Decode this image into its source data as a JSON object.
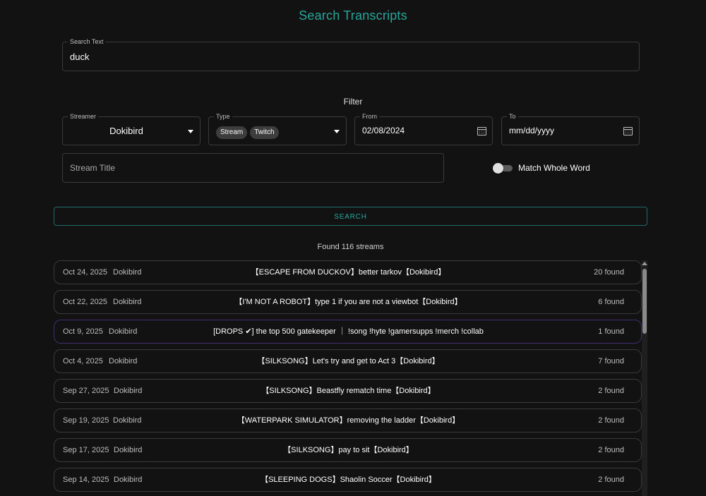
{
  "page": {
    "title": "Search Transcripts"
  },
  "search_text": {
    "label": "Search Text",
    "value": "duck"
  },
  "filter": {
    "heading": "Filter",
    "streamer": {
      "label": "Streamer",
      "value": "Dokibird"
    },
    "type": {
      "label": "Type",
      "chips": [
        "Stream",
        "Twitch"
      ]
    },
    "from": {
      "label": "From",
      "value": "02/08/2024"
    },
    "to": {
      "label": "To",
      "placeholder": "mm/dd/yyyy"
    },
    "stream_title": {
      "placeholder": "Stream Title"
    },
    "match_whole_word": {
      "label": "Match Whole Word",
      "enabled": false
    }
  },
  "search_button": {
    "label": "SEARCH"
  },
  "results": {
    "summary": "Found 116 streams",
    "rows": [
      {
        "date": "Oct 24, 2025",
        "streamer": "Dokibird",
        "title": "【ESCAPE FROM DUCKOV】better tarkov【Dokibird】",
        "count": "20 found"
      },
      {
        "date": "Oct 22, 2025",
        "streamer": "Dokibird",
        "title": "【I'M NOT A ROBOT】type 1 if you are not a viewbot【Dokibird】",
        "count": "6 found"
      },
      {
        "date": "Oct 9, 2025",
        "streamer": "Dokibird",
        "title": "[DROPS ✔] the top 500 gatekeeper ｜ !song !hyte !gamersupps !merch !collab",
        "count": "1 found"
      },
      {
        "date": "Oct 4, 2025",
        "streamer": "Dokibird",
        "title": "【SILKSONG】Let's try and get to Act 3【Dokibird】",
        "count": "7 found"
      },
      {
        "date": "Sep 27, 2025",
        "streamer": "Dokibird",
        "title": "【SILKSONG】Beastfly rematch time【Dokibird】",
        "count": "2 found"
      },
      {
        "date": "Sep 19, 2025",
        "streamer": "Dokibird",
        "title": "【WATERPARK SIMULATOR】removing the ladder【Dokibird】",
        "count": "2 found"
      },
      {
        "date": "Sep 17, 2025",
        "streamer": "Dokibird",
        "title": "【SILKSONG】pay to sit【Dokibird】",
        "count": "2 found"
      },
      {
        "date": "Sep 14, 2025",
        "streamer": "Dokibird",
        "title": "【SLEEPING DOGS】Shaolin Soccer【Dokibird】",
        "count": "2 found"
      }
    ]
  },
  "colors": {
    "accent": "#26a69a",
    "background": "#121212",
    "border": "#3a3a3a",
    "highlight_border": "#3f2f6e"
  }
}
